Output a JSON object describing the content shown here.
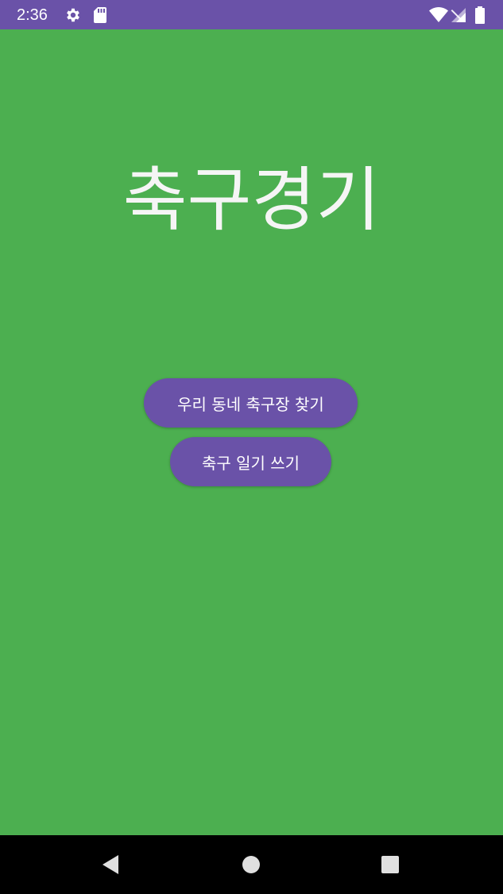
{
  "status_bar": {
    "time": "2:36",
    "icons": [
      "gear-icon",
      "sd-card-icon",
      "wifi-icon",
      "cell-signal-icon",
      "battery-icon"
    ],
    "color": "#6a52a8"
  },
  "main": {
    "title": "축구경기",
    "background_color": "#4caf50",
    "buttons": [
      {
        "label": "우리 동네 축구장 찾기"
      },
      {
        "label": "축구 일기 쓰기"
      }
    ],
    "button_color": "#6a52a8"
  },
  "nav_bar": {
    "icons": [
      "back-icon",
      "home-icon",
      "recents-icon"
    ]
  }
}
